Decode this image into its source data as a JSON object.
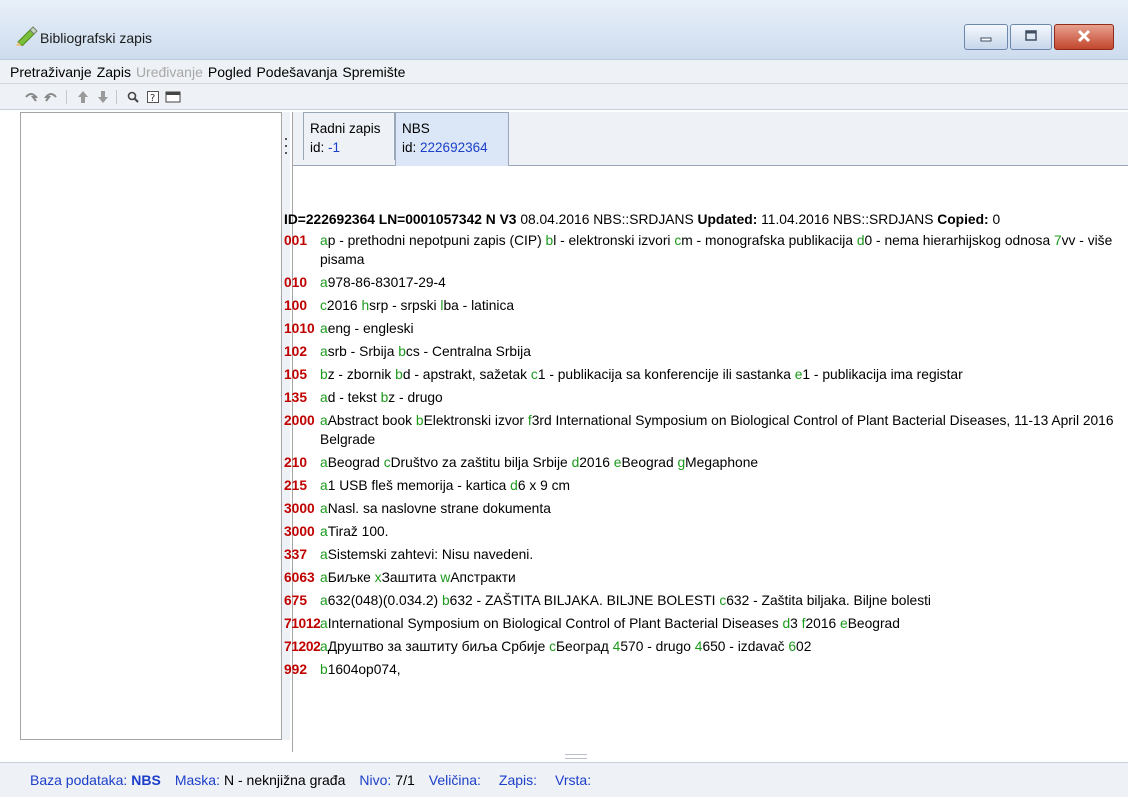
{
  "window": {
    "title": "Bibliografski zapis"
  },
  "menu": [
    "Pretraživanje",
    "Zapis",
    "Uređivanje",
    "Pogled",
    "Podešavanja",
    "Spremište"
  ],
  "menu_disabled": "Uređivanje",
  "tabs": [
    {
      "label": "Radni zapis",
      "id_label": "id:",
      "id_value": "-1"
    },
    {
      "label": "NBS",
      "id_label": "id:",
      "id_value": "222692364"
    }
  ],
  "record": {
    "header": {
      "id": "ID=222692364",
      "ln": "LN=0001057342",
      "nv": "N V3",
      "created": "08.04.2016 NBS::SRDJANS",
      "updated_label": "Updated:",
      "updated": "11.04.2016 NBS::SRDJANS",
      "copied_label": "Copied:",
      "copied": "0"
    },
    "fields": [
      {
        "tag": "001",
        "parts": [
          [
            "a",
            "p - prethodni nepotpuni zapis (CIP) "
          ],
          [
            "b",
            "l - elektronski izvori "
          ],
          [
            "c",
            "m - monografska publikacija "
          ],
          [
            "d",
            "0 - nema hierarhijskog odnosa "
          ],
          [
            "7",
            "vv - više pisama"
          ]
        ]
      },
      {
        "tag": "010",
        "parts": [
          [
            "a",
            "978-86-83017-29-4"
          ]
        ]
      },
      {
        "tag": "100",
        "parts": [
          [
            "c",
            "2016 "
          ],
          [
            "h",
            "srp - srpski "
          ],
          [
            "l",
            "ba - latinica"
          ]
        ]
      },
      {
        "tag": "1010",
        "parts": [
          [
            "a",
            "eng - engleski"
          ]
        ]
      },
      {
        "tag": "102",
        "parts": [
          [
            "a",
            "srb - Srbija "
          ],
          [
            "b",
            "cs - Centralna Srbija"
          ]
        ]
      },
      {
        "tag": "105",
        "parts": [
          [
            "b",
            "z - zbornik "
          ],
          [
            "b",
            "d - apstrakt, sažetak "
          ],
          [
            "c",
            "1 - publikacija sa konferencije ili sastanka "
          ],
          [
            "e",
            "1 - publikacija ima registar"
          ]
        ]
      },
      {
        "tag": "135",
        "parts": [
          [
            "a",
            "d - tekst "
          ],
          [
            "b",
            "z - drugo"
          ]
        ]
      },
      {
        "tag": "2000",
        "parts": [
          [
            "a",
            "Abstract book "
          ],
          [
            "b",
            "Elektronski izvor "
          ],
          [
            "f",
            "3rd International Symposium on Biological Control of Plant Bacterial Diseases, 11-13 April 2016 Belgrade"
          ]
        ]
      },
      {
        "tag": "210",
        "parts": [
          [
            "a",
            "Beograd "
          ],
          [
            "c",
            "Društvo za zaštitu bilja Srbije "
          ],
          [
            "d",
            "2016 "
          ],
          [
            "e",
            "Beograd "
          ],
          [
            "g",
            "Megaphone"
          ]
        ]
      },
      {
        "tag": "215",
        "parts": [
          [
            "a",
            "1 USB fleš memorija - kartica "
          ],
          [
            "d",
            "6 x 9 cm"
          ]
        ]
      },
      {
        "tag": "3000",
        "parts": [
          [
            "a",
            "Nasl. sa naslovne strane dokumenta"
          ]
        ]
      },
      {
        "tag": "3000",
        "parts": [
          [
            "a",
            "Tiraž 100."
          ]
        ]
      },
      {
        "tag": "337",
        "parts": [
          [
            "a",
            "Sistemski zahtevi: Nisu navedeni."
          ]
        ]
      },
      {
        "tag": "6063",
        "parts": [
          [
            "a",
            "Биљке "
          ],
          [
            "x",
            "Заштита "
          ],
          [
            "w",
            "Апстракти"
          ]
        ]
      },
      {
        "tag": "675",
        "parts": [
          [
            "a",
            "632(048)(0.034.2) "
          ],
          [
            "b",
            "632 - ZAŠTITA BILJAKA. BILJNE BOLESTI "
          ],
          [
            "c",
            "632 - Zaštita biljaka. Biljne bolesti"
          ]
        ]
      },
      {
        "tag": "71012",
        "parts": [
          [
            "a",
            "International Symposium on Biological Control of Plant Bacterial Diseases "
          ],
          [
            "d",
            "3 "
          ],
          [
            "f",
            "2016 "
          ],
          [
            "e",
            "Beograd"
          ]
        ]
      },
      {
        "tag": "71202",
        "parts": [
          [
            "a",
            "Друштво за заштиту биља Србије "
          ],
          [
            "c",
            "Београд "
          ],
          [
            "4",
            "570 - drugo "
          ],
          [
            "4",
            "650 - izdavač "
          ],
          [
            "6",
            "02"
          ]
        ]
      },
      {
        "tag": "992",
        "parts": [
          [
            "b",
            "1604op074,"
          ]
        ]
      }
    ]
  },
  "status": {
    "db_label": "Baza podataka:",
    "db_value": "NBS",
    "mask_label": "Maska:",
    "mask_value": "N - neknjižna građa",
    "level_label": "Nivo:",
    "level_value": "7/1",
    "size_label": "Veličina:",
    "size_value": "",
    "record_label": "Zapis:",
    "record_value": "",
    "type_label": "Vrsta:",
    "type_value": ""
  },
  "colors": {
    "tag": "#c00000",
    "subfield": "#1c9a1c",
    "link_blue": "#1c3fc9"
  },
  "icons": [
    "pencil-app-icon",
    "minimize-icon",
    "maximize-icon",
    "close-icon",
    "undo-icon",
    "redo-icon",
    "arrow-up-icon",
    "arrow-down-icon",
    "search-icon",
    "help-icon",
    "card-icon"
  ]
}
